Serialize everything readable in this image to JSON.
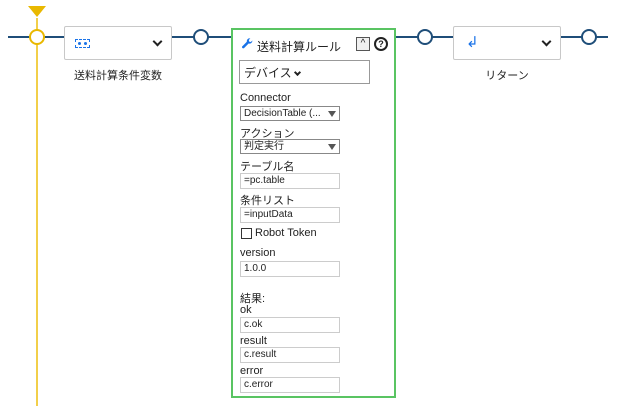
{
  "flow": {
    "step1": {
      "label": "送料計算条件変数",
      "icon": "variable-icon"
    },
    "step3": {
      "label": "リターン",
      "icon": "return-arrow-icon"
    }
  },
  "panel": {
    "title": "送料計算ルール",
    "collapse_glyph": "^",
    "help_glyph": "?",
    "device_label": "デバイス",
    "fields": {
      "connector": {
        "label": "Connector",
        "value": "DecisionTable (..."
      },
      "action": {
        "label": "アクション",
        "value": "判定実行"
      },
      "table_name": {
        "label": "テーブル名",
        "value": "=pc.table"
      },
      "condition_list": {
        "label": "条件リスト",
        "value": "=inputData"
      },
      "robot_token": {
        "label": "Robot Token"
      },
      "version": {
        "label": "version",
        "value": "1.0.0"
      }
    },
    "results": {
      "label": "結果:",
      "ok": {
        "label": "ok",
        "value": "c.ok"
      },
      "result": {
        "label": "result",
        "value": "c.result"
      },
      "error": {
        "label": "error",
        "value": "c.error"
      }
    }
  },
  "colors": {
    "flow_line": "#1f4e79",
    "start_line": "#f2cf4a",
    "panel_border": "#59c462",
    "icon_blue": "#1a73e8"
  }
}
